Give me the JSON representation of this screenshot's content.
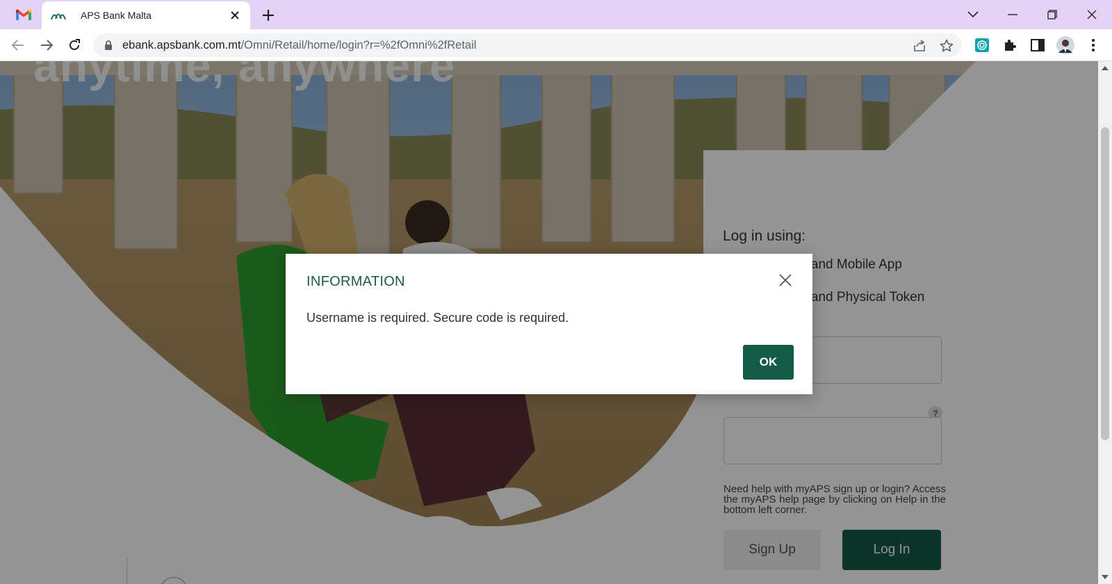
{
  "browser": {
    "pinned_tab_icon": "gmail-icon",
    "tab": {
      "title": "APS Bank Malta",
      "favicon": "aps-bank-logo-icon"
    },
    "url": {
      "host": "ebank.apsbank.com.mt",
      "path": "/Omni/Retail/home/login?r=%2fOmni%2fRetail"
    }
  },
  "page": {
    "hero_heading": "anytime, anywhere",
    "login": {
      "title": "Log in using:",
      "options": [
        {
          "label": "Username and Mobile App",
          "checked": true
        },
        {
          "label": "Username and Physical Token",
          "checked": false
        }
      ],
      "help_badge": "?",
      "help_text": "Need help with myAPS sign up or login? Access the myAPS help page by clicking on Help in the bottom left corner.",
      "signup_label": "Sign Up",
      "login_label": "Log In"
    }
  },
  "dialog": {
    "title": "INFORMATION",
    "message": "Username is required. Secure code is required.",
    "ok_label": "OK"
  },
  "colors": {
    "brand_green": "#135c4a",
    "tab_strip": "#e5d3f5",
    "radio_accent": "#1a73e8"
  }
}
